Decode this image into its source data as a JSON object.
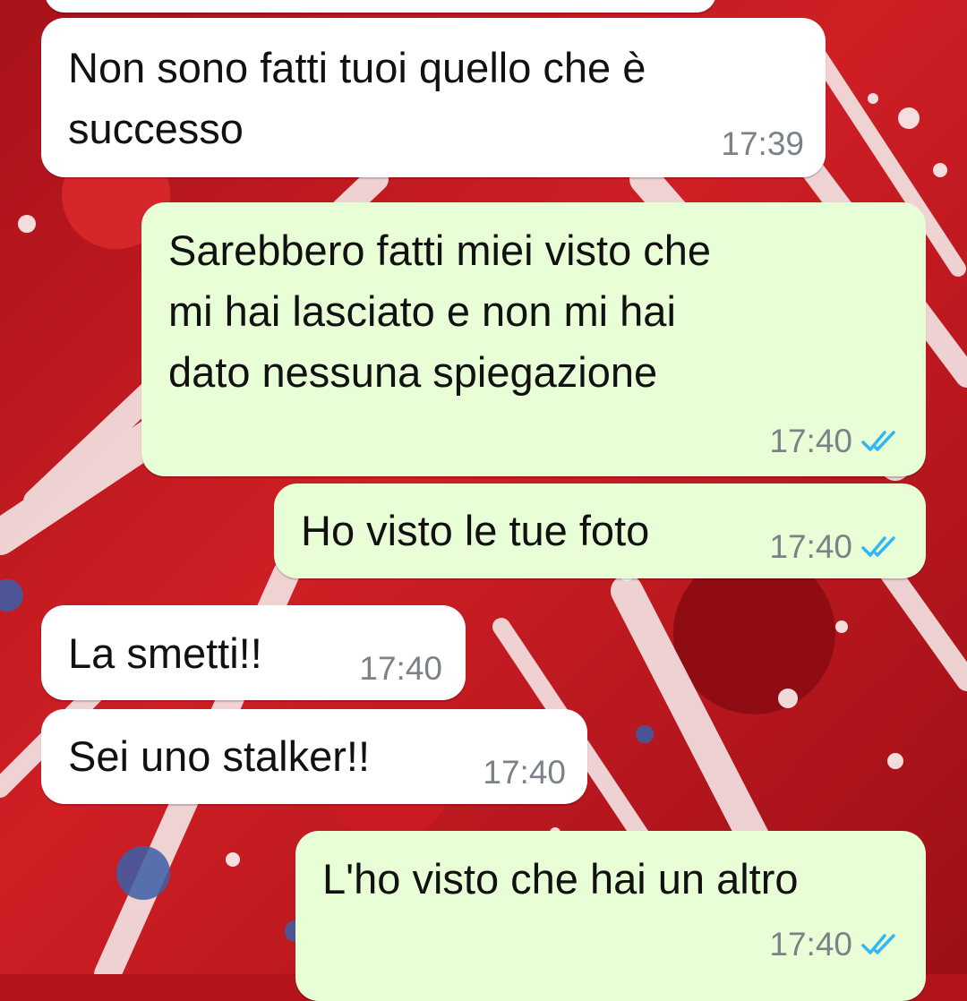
{
  "chat": {
    "messages": [
      {
        "direction": "incoming",
        "text_line1": "Non sono fatti tuoi quello che è",
        "text_line2": "successo",
        "time": "17:39"
      },
      {
        "direction": "outgoing",
        "text_line1": "Sarebbero fatti miei visto che",
        "text_line2": "mi hai lasciato e non mi hai",
        "text_line3": "dato nessuna spiegazione",
        "time": "17:40",
        "status": "read"
      },
      {
        "direction": "outgoing",
        "text": "Ho visto le tue foto",
        "time": "17:40",
        "status": "read"
      },
      {
        "direction": "incoming",
        "text": "La smetti!!",
        "time": "17:40"
      },
      {
        "direction": "incoming",
        "text": "Sei uno stalker!!",
        "time": "17:40"
      },
      {
        "direction": "outgoing",
        "text": "L'ho visto che hai un altro",
        "time": "17:40",
        "status": "read"
      }
    ]
  },
  "colors": {
    "incoming_bubble": "#ffffff",
    "outgoing_bubble": "#e7fed6",
    "read_ticks": "#34b7f1",
    "timestamp": "#7a8288"
  },
  "icons": {
    "read_receipt": "double-check-icon"
  }
}
